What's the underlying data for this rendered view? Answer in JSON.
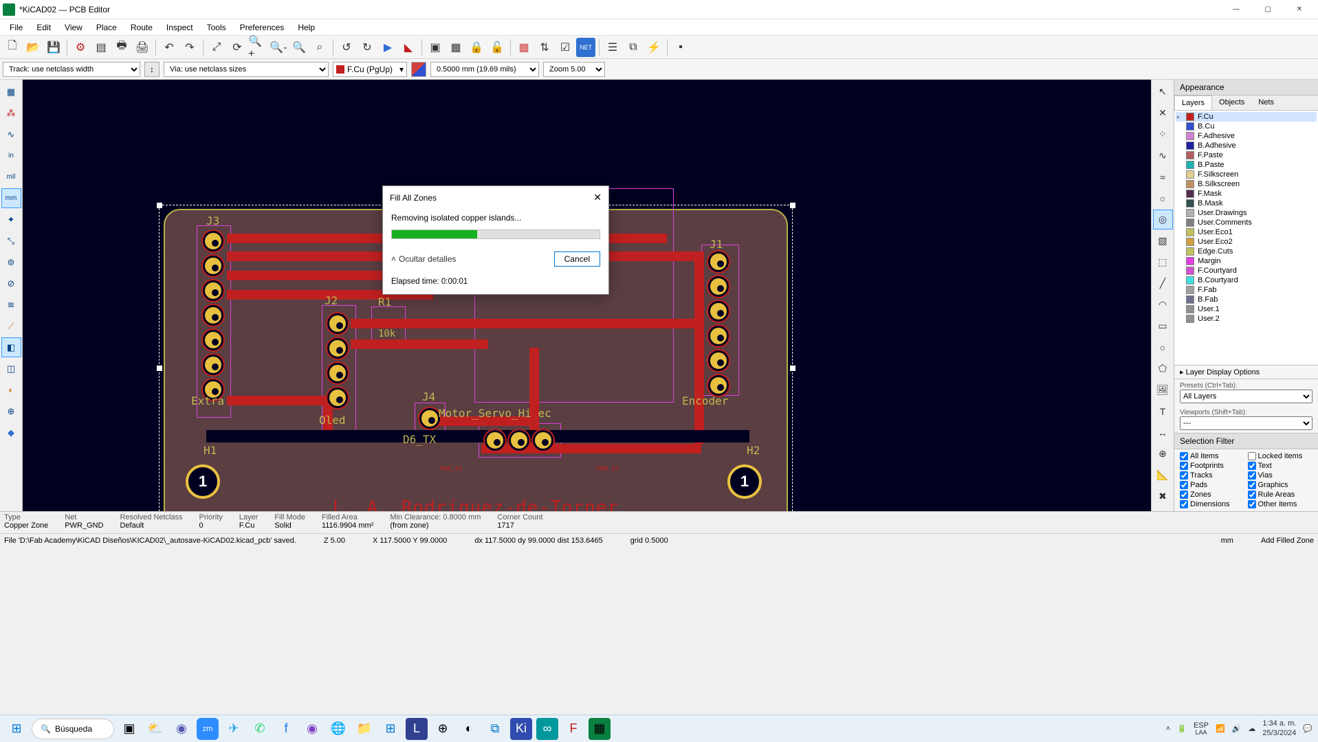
{
  "title": "*KiCAD02 — PCB Editor",
  "menu": [
    "File",
    "Edit",
    "View",
    "Place",
    "Route",
    "Inspect",
    "Tools",
    "Preferences",
    "Help"
  ],
  "toolbar2": {
    "track": "Track: use netclass width",
    "via": "Via: use netclass sizes",
    "layer": "F.Cu (PgUp)",
    "gridsize": "0.5000 mm (19.69 mils)",
    "zoom": "Zoom 5.00"
  },
  "appearance": {
    "header": "Appearance",
    "tabs": [
      "Layers",
      "Objects",
      "Nets"
    ],
    "layers": [
      {
        "name": "F.Cu",
        "color": "#c02020",
        "sel": true
      },
      {
        "name": "B.Cu",
        "color": "#3050d0"
      },
      {
        "name": "F.Adhesive",
        "color": "#d080d0"
      },
      {
        "name": "B.Adhesive",
        "color": "#2020a0"
      },
      {
        "name": "F.Paste",
        "color": "#b06060"
      },
      {
        "name": "B.Paste",
        "color": "#20b0b0"
      },
      {
        "name": "F.Silkscreen",
        "color": "#e0d090"
      },
      {
        "name": "B.Silkscreen",
        "color": "#c09060"
      },
      {
        "name": "F.Mask",
        "color": "#503050"
      },
      {
        "name": "B.Mask",
        "color": "#305050"
      },
      {
        "name": "User.Drawings",
        "color": "#b0b0b0"
      },
      {
        "name": "User.Comments",
        "color": "#808080"
      },
      {
        "name": "User.Eco1",
        "color": "#c0c060"
      },
      {
        "name": "User.Eco2",
        "color": "#d0a040"
      },
      {
        "name": "Edge.Cuts",
        "color": "#c0c060"
      },
      {
        "name": "Margin",
        "color": "#e040e0"
      },
      {
        "name": "F.Courtyard",
        "color": "#d050d0"
      },
      {
        "name": "B.Courtyard",
        "color": "#40e0e0"
      },
      {
        "name": "F.Fab",
        "color": "#a0a0a0"
      },
      {
        "name": "B.Fab",
        "color": "#707090"
      },
      {
        "name": "User.1",
        "color": "#909090"
      },
      {
        "name": "User.2",
        "color": "#909090"
      }
    ],
    "ldo": "Layer Display Options",
    "presets_lbl": "Presets (Ctrl+Tab):",
    "presets_val": "All Layers",
    "viewports_lbl": "Viewports (Shift+Tab):",
    "viewports_val": "---"
  },
  "selfilter": {
    "header": "Selection Filter",
    "items": [
      {
        "l": "All items",
        "c": true
      },
      {
        "l": "Locked items",
        "c": false
      },
      {
        "l": "Footprints",
        "c": true
      },
      {
        "l": "Text",
        "c": true
      },
      {
        "l": "Tracks",
        "c": true
      },
      {
        "l": "Vias",
        "c": true
      },
      {
        "l": "Pads",
        "c": true
      },
      {
        "l": "Graphics",
        "c": true
      },
      {
        "l": "Zones",
        "c": true
      },
      {
        "l": "Rule Areas",
        "c": true
      },
      {
        "l": "Dimensions",
        "c": true
      },
      {
        "l": "Other items",
        "c": true
      }
    ]
  },
  "status1": [
    {
      "l1": "Type",
      "l2": "Copper Zone"
    },
    {
      "l1": "Net",
      "l2": "PWR_GND"
    },
    {
      "l1": "Resolved Netclass",
      "l2": "Default"
    },
    {
      "l1": "Priority",
      "l2": "0"
    },
    {
      "l1": "Layer",
      "l2": "F.Cu"
    },
    {
      "l1": "Fill Mode",
      "l2": "Solid"
    },
    {
      "l1": "Filled Area",
      "l2": "1116.9904 mm²"
    },
    {
      "l1": "Min Clearance: 0.8000 mm",
      "l2": "(from zone)"
    },
    {
      "l1": "Corner Count",
      "l2": "1717"
    }
  ],
  "status2": {
    "msg": "File 'D:\\Fab Academy\\KiCAD Diseños\\KICAD02\\_autosave-KiCAD02.kicad_pcb' saved.",
    "z": "Z 5.00",
    "xy": "X 117.5000  Y 99.0000",
    "dxy": "dx 117.5000  dy 99.0000  dist 153.6465",
    "grid": "grid 0.5000",
    "unit": "mm",
    "mode": "Add Filled Zone"
  },
  "dialog": {
    "title": "Fill All Zones",
    "msg": "Removing isolated copper islands...",
    "details": "Ocultar detalles",
    "cancel": "Cancel",
    "elapsed": "Elapsed time: 0:00:01"
  },
  "pcb": {
    "labels": {
      "J3": "J3",
      "J2": "J2",
      "R1": "R1",
      "J4": "J4",
      "J1": "J1",
      "H1": "H1",
      "H2": "H2",
      "Extra": "Extra",
      "Oled": "Oled",
      "D6TX": "D6_TX",
      "Motor": "Motor_Servo_Hi ec",
      "Encoder": "Encoder",
      "r10k": "10k",
      "author": "L. A. Rodríguez-de-Torner",
      "pwr5v_1": "PWR_5V",
      "pwr5v_2": "PWR_5V",
      "pwr5v_3": "PWR_5V",
      "one": "1"
    }
  },
  "taskbar": {
    "search": "Búsqueda",
    "lang1": "ESP",
    "lang2": "LAA",
    "time": "1:34 a. m.",
    "date": "25/3/2024"
  }
}
